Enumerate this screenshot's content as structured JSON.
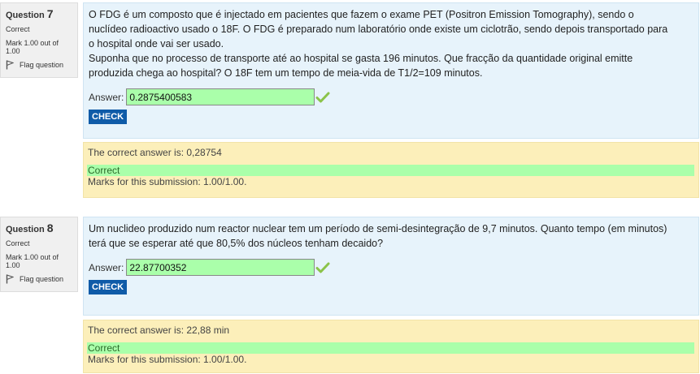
{
  "questions": [
    {
      "label": "Question",
      "number": "7",
      "state": "Correct",
      "grade": "Mark 1.00 out of 1.00",
      "flag_label": "Flag question",
      "text_lines": [
        "O FDG é um composto que é injectado em pacientes que fazem o exame PET (Positron Emission Tomography), sendo o",
        "nuclídeo radioactivo usado o 18F. O FDG é preparado num laboratório onde existe um ciclotrão, sendo depois transportado para",
        "o hospital onde vai ser usado.",
        "Suponha que no processo de transporte até ao hospital se gasta 196 minutos. Que fracção da quantidade original emitte",
        "produzida chega ao hospital? O 18F tem um tempo de meia-vida de T1/2=109 minutos."
      ],
      "answer_label": "Answer:",
      "answer_value": "0.2875400583",
      "check_label": "CHECK",
      "right_answer": "The correct answer is: 0,28754",
      "feedback": "Correct",
      "marks": "Marks for this submission: 1.00/1.00."
    },
    {
      "label": "Question",
      "number": "8",
      "state": "Correct",
      "grade": "Mark 1.00 out of 1.00",
      "flag_label": "Flag question",
      "text_lines": [
        "Um nuclideo produzido num reactor nuclear tem um período de semi-desintegração de 9,7 minutos. Quanto tempo (em minutos)",
        "terá que se esperar até que 80,5% dos núcleos tenham decaido?"
      ],
      "answer_label": "Answer:",
      "answer_value": "22.87700352",
      "check_label": "CHECK",
      "right_answer": "The correct answer is: 22,88 min",
      "feedback": "Correct",
      "marks": "Marks for this submission: 1.00/1.00."
    }
  ],
  "colors": {
    "info_bg": "#f0f0f0",
    "formulation_bg": "#e7f3fb",
    "outcome_bg": "#fcefba",
    "correct_bg": "#aaffaa",
    "check_button": "#0f5ba8",
    "tick": "#8bc34a"
  },
  "icons": {
    "flag": "flag-outline-icon",
    "tick": "checkmark-icon"
  }
}
